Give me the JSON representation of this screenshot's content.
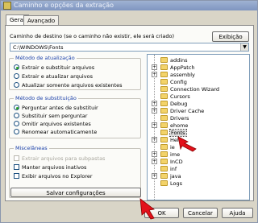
{
  "window": {
    "title": "Caminho e opções da extração"
  },
  "tabs": [
    {
      "label": "Geral",
      "active": true
    },
    {
      "label": "Avançado",
      "active": false
    }
  ],
  "destination": {
    "label": "Caminho de destino (se o caminho não existir, ele será criado)",
    "value": "C:\\WINDOWS\\Fonts",
    "show_button": "Exibição"
  },
  "update_mode": {
    "title": "Método de atualização",
    "options": [
      {
        "label": "Extrair e substituir arquivos",
        "selected": true
      },
      {
        "label": "Extrair e atualizar arquivos",
        "selected": false
      },
      {
        "label": "Atualizar somente arquivos existentes",
        "selected": false
      }
    ]
  },
  "overwrite_mode": {
    "title": "Método de substituição",
    "options": [
      {
        "label": "Perguntar antes de substituir",
        "selected": true
      },
      {
        "label": "Substituir sem perguntar",
        "selected": false
      },
      {
        "label": "Omitir arquivos existentes",
        "selected": false
      },
      {
        "label": "Renomear automaticamente",
        "selected": false
      }
    ]
  },
  "misc": {
    "title": "Miscelâneas",
    "options": [
      {
        "label": "Extrair arquivos para subpastas",
        "enabled": false
      },
      {
        "label": "Manter arquivos inativos",
        "enabled": true
      },
      {
        "label": "Exibir arquivos no Explorer",
        "enabled": true
      }
    ],
    "save_button": "Salvar configurações"
  },
  "tree": {
    "items": [
      {
        "label": "addins",
        "expandable": false
      },
      {
        "label": "AppPatch",
        "expandable": true
      },
      {
        "label": "assembly",
        "expandable": true
      },
      {
        "label": "Config",
        "expandable": false
      },
      {
        "label": "Connection Wizard",
        "expandable": false
      },
      {
        "label": "Cursors",
        "expandable": false
      },
      {
        "label": "Debug",
        "expandable": true
      },
      {
        "label": "Driver Cache",
        "expandable": true
      },
      {
        "label": "Drivers",
        "expandable": false
      },
      {
        "label": "ehome",
        "expandable": true
      },
      {
        "label": "Fonts",
        "expandable": false,
        "selected": true
      },
      {
        "label": "Hel",
        "expandable": true
      },
      {
        "label": "ie",
        "expandable": false
      },
      {
        "label": "ime",
        "expandable": true
      },
      {
        "label": "InCD",
        "expandable": true
      },
      {
        "label": "inf",
        "expandable": false
      },
      {
        "label": "java",
        "expandable": true
      },
      {
        "label": "Logs",
        "expandable": false
      }
    ]
  },
  "footer": {
    "ok": "OK",
    "cancel": "Cancelar",
    "help": "Ajuda"
  },
  "colors": {
    "title_bar": "#8fa3cb",
    "group_title": "#1a3fa8",
    "annotation_arrow": "#e3101a"
  },
  "icons": {
    "app": "winrar-icon",
    "folder": "folder-icon",
    "annotation": "red-arrow-icon"
  }
}
